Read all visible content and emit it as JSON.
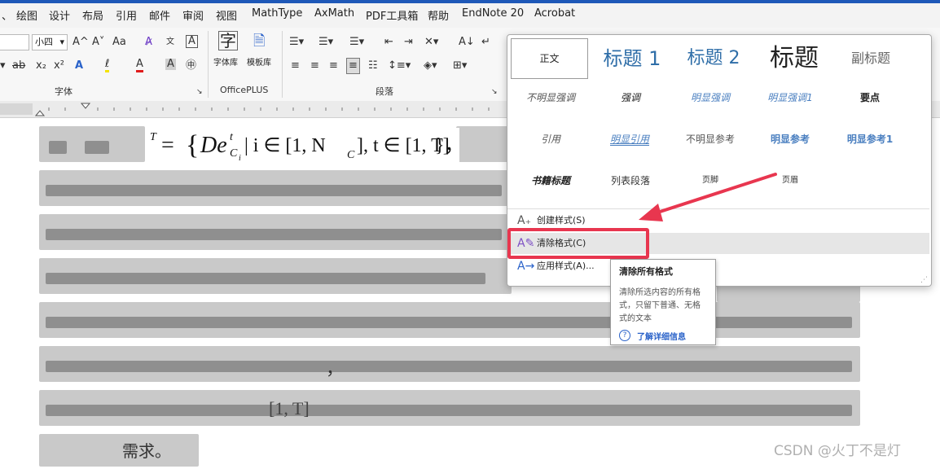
{
  "menubar": {
    "items": [
      "、",
      "绘图",
      "设计",
      "布局",
      "引用",
      "邮件",
      "审阅",
      "视图",
      "MathType",
      "AxMath",
      "PDF工具箱",
      "帮助",
      "EndNote 20",
      "Acrobat"
    ]
  },
  "ribbon": {
    "font_size_value": "小四",
    "font_group_label": "字体",
    "plugin_group_label": "OfficePLUS",
    "paragraph_group_label": "段落",
    "font_lib_char": "字",
    "font_lib_label": "字体库",
    "template_lib_label": "模板库",
    "font_grow": "A^",
    "font_shrink": "A˅",
    "change_case": "Aa",
    "phonetic_char": "文",
    "char_border": "A",
    "strikethrough": "ab",
    "subscript": "x₂",
    "superscript": "x²",
    "text_effect": "A",
    "highlight": "ℓ",
    "font_color": "A",
    "char_shading": "A",
    "enclosed_char": "㊥"
  },
  "doc": {
    "formula_prefix": "= ",
    "formula_main": "De",
    "formula_sup": "t",
    "formula_sub": "C",
    "formula_subsub": "i",
    "formula_rest": " | i ∈ [1, N",
    "formula_nc_sub": "C",
    "formula_rest2": "], t ∈ [1, T]",
    "formula_close": "}，",
    "formula_sup_T": "T",
    "interval_text": "[1, T]",
    "end_text": "需求。",
    "comma": "，"
  },
  "styles_panel": {
    "row1": [
      "正文",
      "标题 1",
      "标题 2",
      "标题",
      "副标题"
    ],
    "row2": [
      "不明显强调",
      "强调",
      "明显强调",
      "明显强调1",
      "要点"
    ],
    "row3": [
      "引用",
      "明显引用",
      "不明显参考",
      "明显参考",
      "明显参考1"
    ],
    "row4": [
      "书籍标题",
      "列表段落",
      "页脚",
      "页眉"
    ],
    "menu": [
      {
        "icon": "A₊",
        "label": "创建样式(S)"
      },
      {
        "icon": "A✎",
        "label": "清除格式(C)"
      },
      {
        "icon": "A→",
        "label": "应用样式(A)..."
      }
    ]
  },
  "tooltip": {
    "title": "清除所有格式",
    "line1": "清除所选内容的所有格",
    "line2": "式，只留下普通、无格",
    "line3": "式的文本",
    "help_icon": "?",
    "link": "了解详细信息"
  },
  "watermark": "CSDN @火丁不是灯",
  "colors": {
    "accent_red": "#e8364f",
    "heading_blue": "#2f6ea8",
    "title_bar_blue": "#1e58b8"
  }
}
